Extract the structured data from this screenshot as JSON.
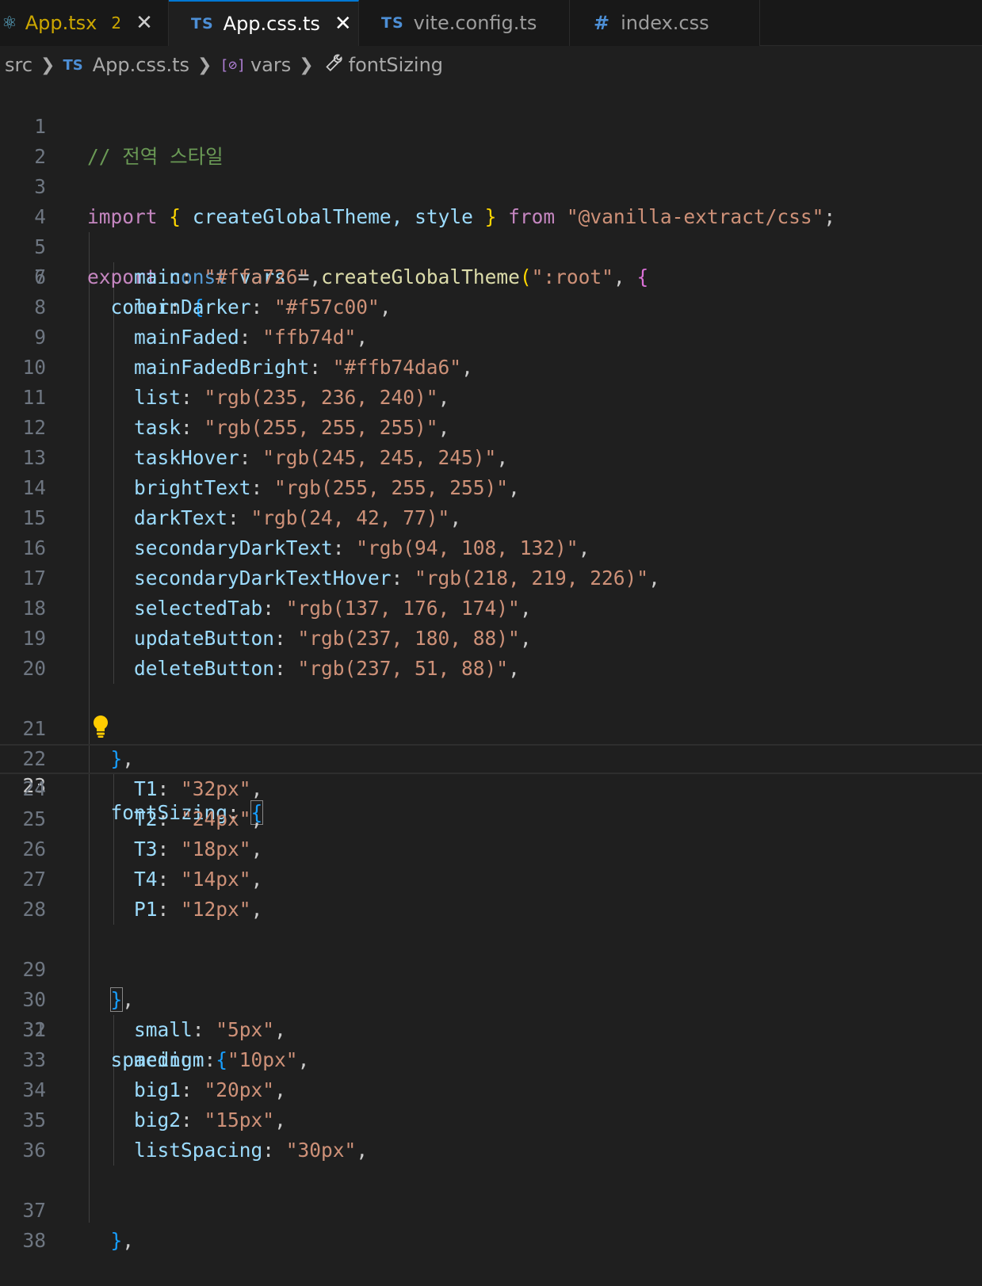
{
  "tabs": [
    {
      "label": "App.tsx",
      "icon": "react-icon",
      "problems": "2",
      "close": "✕"
    },
    {
      "label": "App.css.ts",
      "icon": "TS",
      "close": "✕",
      "active": true
    },
    {
      "label": "vite.config.ts",
      "icon": "TS"
    },
    {
      "label": "index.css",
      "icon": "#"
    }
  ],
  "breadcrumb": {
    "items": [
      "src",
      "App.css.ts",
      "vars",
      "fontSizing"
    ],
    "ts_badge": "TS"
  },
  "editor": {
    "current_line": 23,
    "lines": [
      {
        "n": "1"
      },
      {
        "n": "2"
      },
      {
        "n": "3"
      },
      {
        "n": "4"
      },
      {
        "n": "5"
      },
      {
        "n": "6"
      },
      {
        "n": "7"
      },
      {
        "n": "8"
      },
      {
        "n": "9"
      },
      {
        "n": "10"
      },
      {
        "n": "11"
      },
      {
        "n": "12"
      },
      {
        "n": "13"
      },
      {
        "n": "14"
      },
      {
        "n": "15"
      },
      {
        "n": "16"
      },
      {
        "n": "17"
      },
      {
        "n": "18"
      },
      {
        "n": "19"
      },
      {
        "n": "20"
      },
      {
        "n": "21"
      },
      {
        "n": "22"
      },
      {
        "n": "23"
      },
      {
        "n": "24"
      },
      {
        "n": "25"
      },
      {
        "n": "26"
      },
      {
        "n": "27"
      },
      {
        "n": "28"
      },
      {
        "n": "29"
      },
      {
        "n": "30"
      },
      {
        "n": "31"
      },
      {
        "n": "32"
      },
      {
        "n": "33"
      },
      {
        "n": "34"
      },
      {
        "n": "35"
      },
      {
        "n": "36"
      },
      {
        "n": "37"
      },
      {
        "n": "38"
      }
    ],
    "code": {
      "l1": "// 전역 스타일",
      "l3_import": "import",
      "l3_names": "createGlobalTheme, style",
      "l3_from": "from",
      "l3_module": "\"@vanilla-extract/css\"",
      "l5_export": "export",
      "l5_const": "const",
      "l5_vars": "vars",
      "l5_fn": "createGlobalTheme",
      "l5_arg": "\":root\"",
      "color_key": "color",
      "colors": [
        {
          "key": "main",
          "value": "\"#ffa726\""
        },
        {
          "key": "mainDarker",
          "value": "\"#f57c00\""
        },
        {
          "key": "mainFaded",
          "value": "\"ffb74d\""
        },
        {
          "key": "mainFadedBright",
          "value": "\"#ffb74da6\""
        },
        {
          "key": "list",
          "value": "\"rgb(235, 236, 240)\""
        },
        {
          "key": "task",
          "value": "\"rgb(255, 255, 255)\""
        },
        {
          "key": "taskHover",
          "value": "\"rgb(245, 245, 245)\""
        },
        {
          "key": "brightText",
          "value": "\"rgb(255, 255, 255)\""
        },
        {
          "key": "darkText",
          "value": "\"rgb(24, 42, 77)\""
        },
        {
          "key": "secondaryDarkText",
          "value": "\"rgb(94, 108, 132)\""
        },
        {
          "key": "secondaryDarkTextHover",
          "value": "\"rgb(218, 219, 226)\""
        },
        {
          "key": "selectedTab",
          "value": "\"rgb(137, 176, 174)\""
        },
        {
          "key": "updateButton",
          "value": "\"rgb(237, 180, 88)\""
        },
        {
          "key": "deleteButton",
          "value": "\"rgb(237, 51, 88)\""
        }
      ],
      "fontsizing_key": "fontSizing",
      "fontsizes": [
        {
          "key": "T1",
          "value": "\"32px\""
        },
        {
          "key": "T2",
          "value": "\"24px\""
        },
        {
          "key": "T3",
          "value": "\"18px\""
        },
        {
          "key": "T4",
          "value": "\"14px\""
        },
        {
          "key": "P1",
          "value": "\"12px\""
        }
      ],
      "spacing_key": "spacing",
      "spacings": [
        {
          "key": "small",
          "value": "\"5px\""
        },
        {
          "key": "medium",
          "value": "\"10px\""
        },
        {
          "key": "big1",
          "value": "\"20px\""
        },
        {
          "key": "big2",
          "value": "\"15px\""
        },
        {
          "key": "listSpacing",
          "value": "\"30px\""
        }
      ]
    }
  },
  "colors": {
    "editor_bg": "#1f1f1f",
    "tab_bar_bg": "#181818",
    "string": "#ce9178",
    "keyword": "#c586c0",
    "property": "#9cdcfe",
    "function": "#dcdcaa",
    "comment": "#6a9955",
    "bracket_level1": "#ffd700",
    "bracket_level2": "#da70d6",
    "bracket_level3": "#179fff"
  }
}
